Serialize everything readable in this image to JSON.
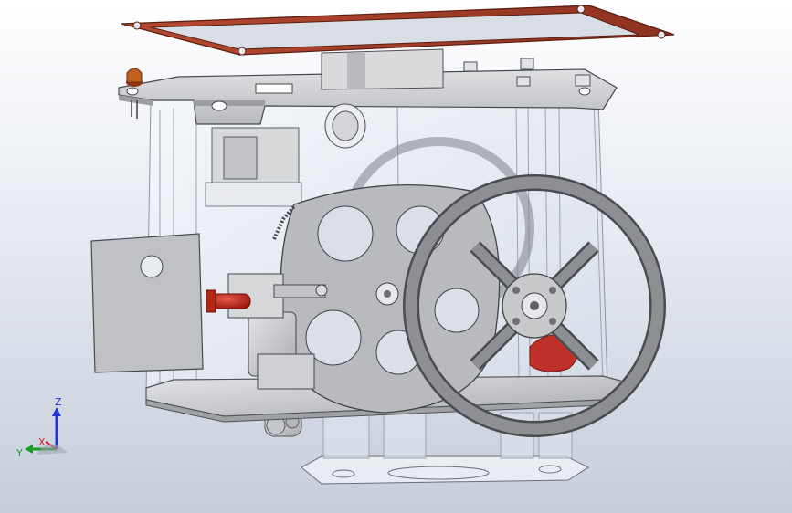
{
  "view": {
    "type": "CAD 3D assembly viewport",
    "background_top": "#ffffff",
    "background_bottom": "#c6ceda"
  },
  "model": {
    "part_colors": {
      "gasket": "#a9402a",
      "metal": "#c8c9cb",
      "metal_dark": "#8e9094",
      "wheel": "#9a9b9e",
      "red_knob": "#c2281a",
      "red_fan": "#c0302a",
      "orange_led": "#c0601f",
      "transparent_acrylic": "#e8eef7"
    }
  },
  "triad": {
    "z_label": "Z",
    "x_label": "X",
    "y_label": "Y",
    "z_color": "#2135d6",
    "x_color": "#d12121",
    "y_color": "#1d9a2a"
  }
}
